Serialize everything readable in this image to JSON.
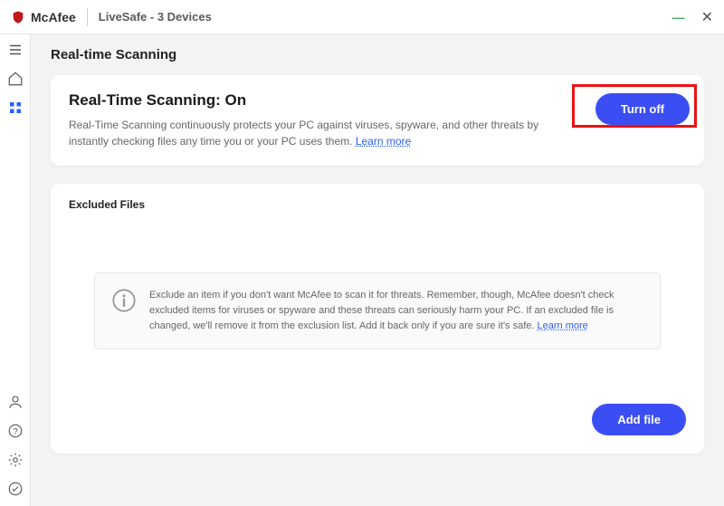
{
  "titlebar": {
    "brand": "McAfee",
    "product": "LiveSafe - 3 Devices"
  },
  "page": {
    "title": "Real-time Scanning"
  },
  "status_card": {
    "heading": "Real-Time Scanning: On",
    "description": "Real-Time Scanning continuously protects your PC against viruses, spyware, and other threats by instantly checking files any time you or your PC uses them. ",
    "learn_more": "Learn more",
    "turn_off_label": "Turn off"
  },
  "excluded": {
    "heading": "Excluded Files",
    "info": "Exclude an item if you don't want McAfee to scan it for threats. Remember, though, McAfee doesn't check excluded items for viruses or spyware and these threats can seriously harm your PC. If an excluded file is changed, we'll remove it from the exclusion list. Add it back only if you are sure it's safe. ",
    "learn_more": "Learn more",
    "add_file_label": "Add file"
  },
  "colors": {
    "primary": "#3b4ef4",
    "highlight": "#e11"
  }
}
